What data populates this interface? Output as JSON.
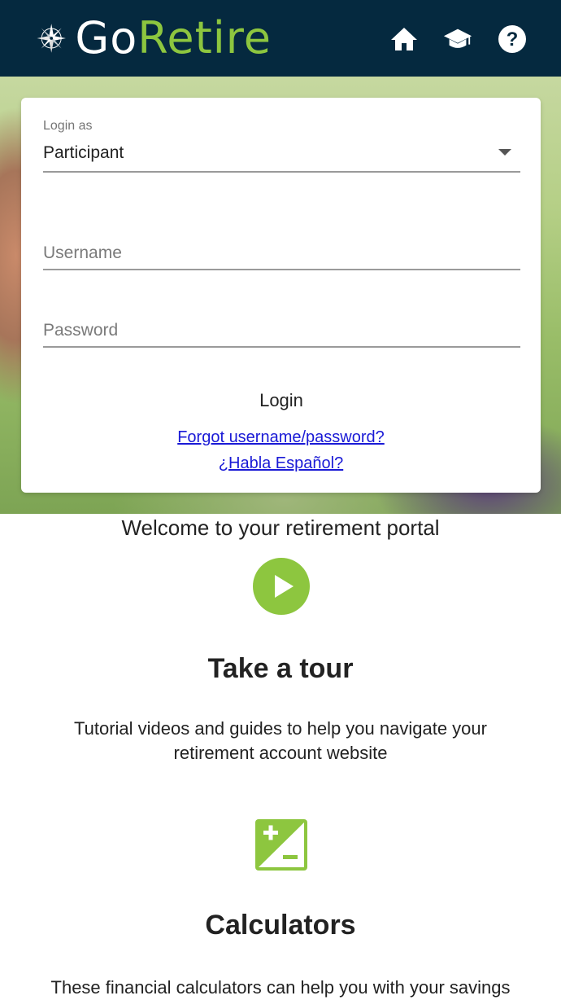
{
  "header": {
    "brand_go": "Go",
    "brand_retire": "Retire",
    "icons": [
      "home-icon",
      "graduation-cap-icon",
      "help-circle-icon"
    ],
    "colors": {
      "background": "#05293f",
      "accent": "#8dc63f"
    }
  },
  "login": {
    "login_as_label": "Login as",
    "login_as_value": "Participant",
    "username_placeholder": "Username",
    "password_placeholder": "Password",
    "username_value": "",
    "password_value": "",
    "login_button": "Login",
    "forgot_link": "Forgot username/password?",
    "spanish_link": "¿Habla Español?"
  },
  "main": {
    "welcome": "Welcome to your retirement portal",
    "tour": {
      "icon": "play-icon",
      "title": "Take a tour",
      "description": "Tutorial videos and guides to help you navigate your retirement account website"
    },
    "calculators": {
      "icon": "calculator-plus-minus-icon",
      "title": "Calculators",
      "description": "These financial calculators can help you with your savings"
    }
  }
}
